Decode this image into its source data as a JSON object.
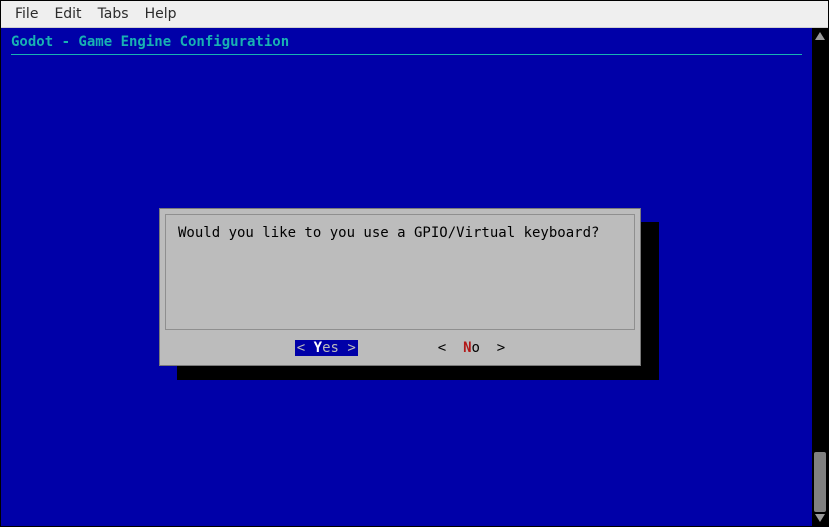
{
  "menubar": {
    "items": [
      {
        "label": "File"
      },
      {
        "label": "Edit"
      },
      {
        "label": "Tabs"
      },
      {
        "label": "Help"
      }
    ]
  },
  "terminal": {
    "title": "Godot - Game Engine Configuration"
  },
  "dialog": {
    "message": "Would you like to you use a GPIO/Virtual keyboard?",
    "yes": {
      "left": "< ",
      "hot": "Y",
      "rest": "es >"
    },
    "no": {
      "left": "<  ",
      "hot": "N",
      "rest": "o  >"
    }
  }
}
